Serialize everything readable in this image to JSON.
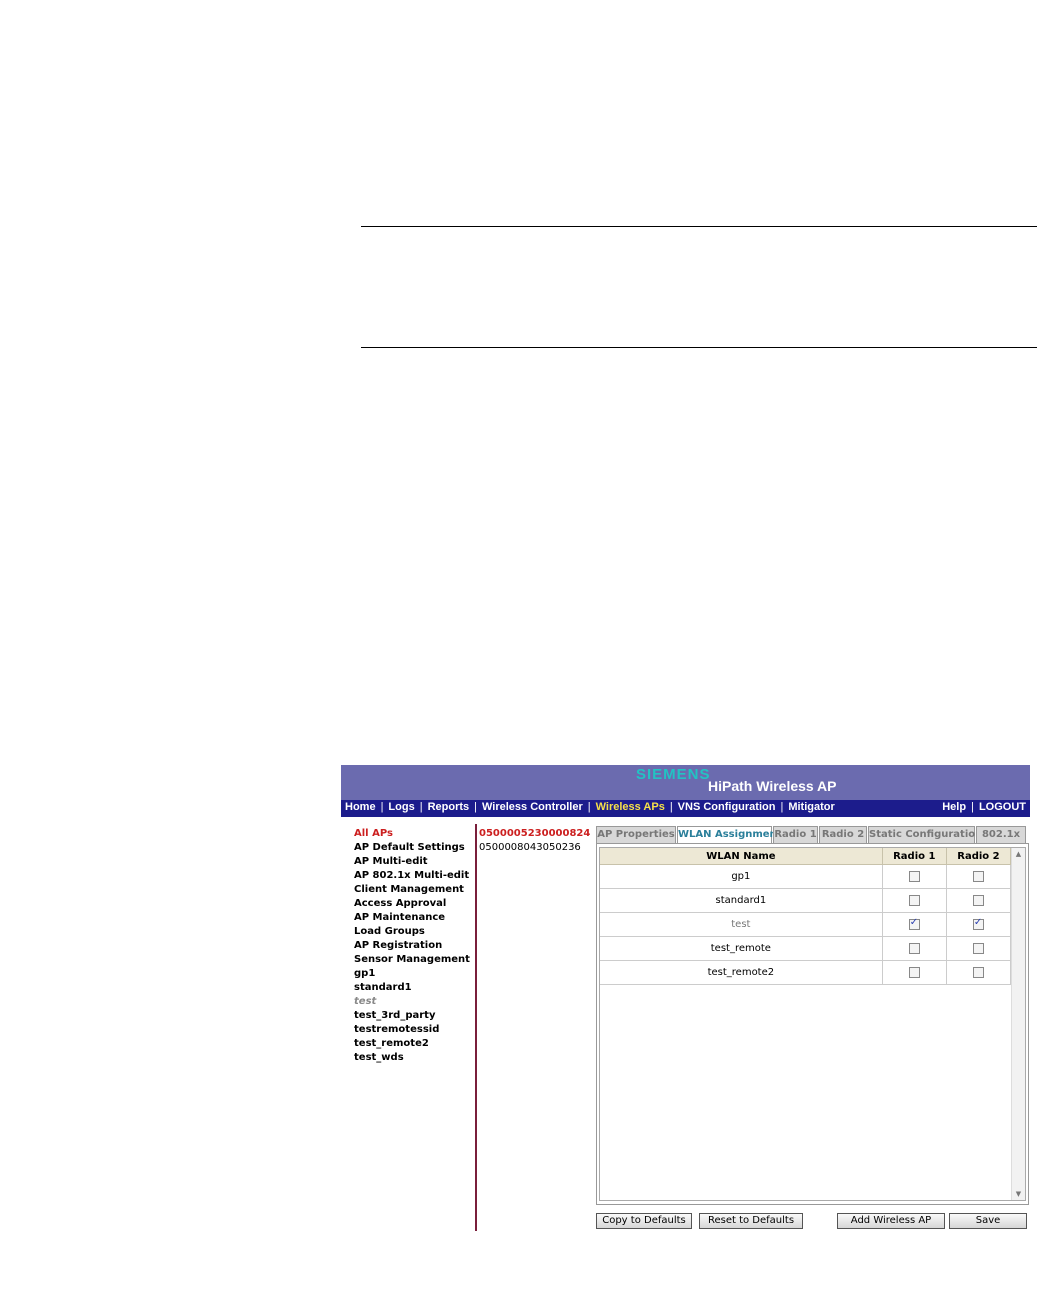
{
  "brand": {
    "logo": "SIEMENS",
    "product": "HiPath Wireless AP"
  },
  "nav": {
    "left": [
      "Home",
      "Logs",
      "Reports",
      "Wireless Controller",
      "Wireless APs",
      "VNS Configuration",
      "Mitigator"
    ],
    "active": "Wireless APs",
    "right": [
      "Help",
      "LOGOUT"
    ]
  },
  "left_menu": {
    "items": [
      "All APs",
      "AP Default Settings",
      "AP Multi-edit",
      "AP 802.1x Multi-edit",
      "Client Management",
      "Access Approval",
      "AP Maintenance",
      "Load Groups",
      "AP Registration",
      "Sensor Management",
      "gp1",
      "standard1",
      "test",
      "test_3rd_party",
      "testremotessid",
      "test_remote2",
      "test_wds"
    ],
    "selected": "All APs",
    "dimmed": "test"
  },
  "ap_list": {
    "items": [
      "0500005230000824",
      "0500008043050236"
    ],
    "selected": "0500005230000824"
  },
  "tabs": {
    "labels": [
      "AP Properties",
      "WLAN Assignment",
      "Radio 1",
      "Radio 2",
      "Static Configuration",
      "802.1x"
    ],
    "active": "WLAN Assignment"
  },
  "grid": {
    "headers": [
      "WLAN Name",
      "Radio 1",
      "Radio 2"
    ],
    "rows": [
      {
        "name": "gp1",
        "radio1": false,
        "radio2": false
      },
      {
        "name": "standard1",
        "radio1": false,
        "radio2": false
      },
      {
        "name": "test",
        "radio1": true,
        "radio2": true
      },
      {
        "name": "test_remote",
        "radio1": false,
        "radio2": false
      },
      {
        "name": "test_remote2",
        "radio1": false,
        "radio2": false
      }
    ]
  },
  "buttons": {
    "copy_defaults": "Copy to Defaults",
    "reset_defaults": "Reset to Defaults",
    "add_ap": "Add Wireless AP",
    "save": "Save"
  }
}
